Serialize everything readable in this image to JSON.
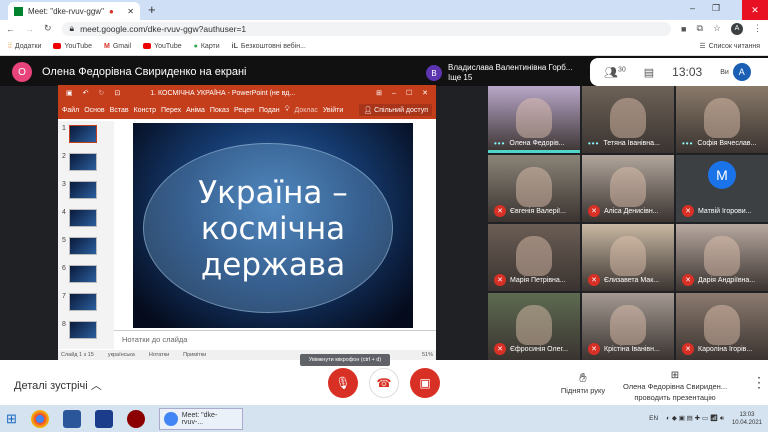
{
  "browser": {
    "tab_title": "Meet: \"dke-rvuv-ggw\"",
    "url": "meet.google.com/dke-rvuv-ggw?authuser=1",
    "profile_initial": "A",
    "bookmarks": [
      "Додатки",
      "YouTube",
      "Gmail",
      "YouTube",
      "Карти",
      "Безкоштовні вебін..."
    ],
    "reading_list": "Список читання"
  },
  "meet": {
    "presenter_initial": "O",
    "presenter_label": "Олена Федорівна Свириденко на екрані",
    "speaker_initial": "B",
    "speaker_name": "Владислава Валентинівна Горб...",
    "speaker_more": "Іще 15",
    "participants_count": "30",
    "clock": "13:03",
    "me_initial": "A",
    "me_label": "Ви",
    "tiles": [
      {
        "name": "Олена Федорів...",
        "muted": false,
        "bg": "#b9a7c9"
      },
      {
        "name": "Тетяна Іванівна...",
        "muted": false,
        "bg": "#6d6257"
      },
      {
        "name": "Софія Вячеслав...",
        "muted": false,
        "bg": "#8a7a6a"
      },
      {
        "name": "Євгенія Валерії...",
        "muted": true,
        "bg": "#8a8478"
      },
      {
        "name": "Аліса Денисівн...",
        "muted": true,
        "bg": "#b2a69c"
      },
      {
        "name": "Матвій Ігорови...",
        "muted": true,
        "bg": "#3c4043",
        "initial": "M"
      },
      {
        "name": "Марія Петрівна...",
        "muted": true,
        "bg": "#6b5e55"
      },
      {
        "name": "Єлизавета Мак...",
        "muted": true,
        "bg": "#c9b9a3"
      },
      {
        "name": "Дарія Андріївна...",
        "muted": true,
        "bg": "#b8a9a0"
      },
      {
        "name": "Єфросинія Олег...",
        "muted": true,
        "bg": "#5e6b52"
      },
      {
        "name": "Крістіна Іванівн...",
        "muted": true,
        "bg": "#a49a92"
      },
      {
        "name": "Кароліна Ігорів...",
        "muted": true,
        "bg": "#8c7b70"
      }
    ],
    "details": "Деталі зустрічі",
    "mic_tooltip": "Увімкнути мікрофон (ctrl + d)",
    "raise_hand": "Підняти руку",
    "presenting_name": "Олена Федорівна Свириден...",
    "presenting_sub": "проводить презентацію"
  },
  "ppt": {
    "title": "1. КОСМІЧНА УКРАЇНА - PowerPoint (не вд...",
    "ribbon": [
      "Файл",
      "Основ",
      "Встав",
      "Констр",
      "Перех",
      "Аніма",
      "Показ",
      "Рецен",
      "Подан",
      "Доклас",
      "Увійти"
    ],
    "share": "Спільний доступ",
    "thumbs": [
      "1",
      "2",
      "3",
      "4",
      "5",
      "6",
      "7",
      "8"
    ],
    "slide_title": "Україна – космічна держава",
    "notes": "Нотатки до слайда",
    "status": [
      "Слайд 1 з 15",
      "українська",
      "Нотатки",
      "Примітки",
      "51%"
    ]
  },
  "taskbar": {
    "task_label": "Meet: \"dke-rvuv-...",
    "lang": "EN",
    "time": "13:03",
    "date": "10.04.2021"
  }
}
